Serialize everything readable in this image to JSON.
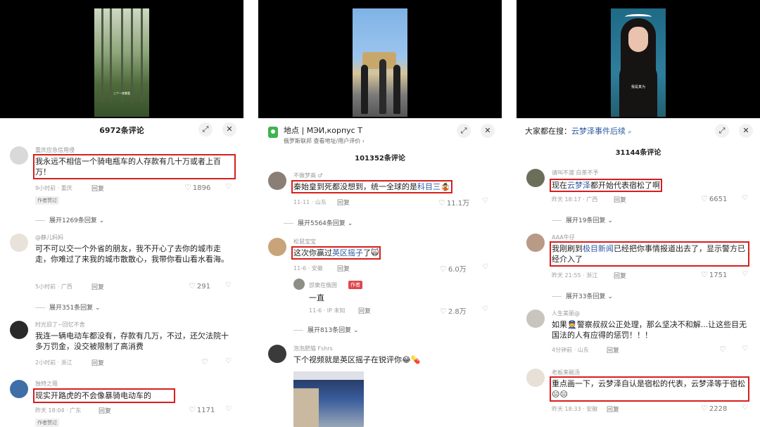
{
  "panel1": {
    "thumb_caption": "三个一夜暴富",
    "comment_count": "6972条评论",
    "comments": [
      {
        "user": "重庆应急信用侵",
        "text": "我永远不相信一个骑电瓶车的人存款有几十万或者上百万！",
        "time": "9小时前 · 重庆",
        "reply": "回复",
        "likes": "1896",
        "badge": "作者赞过",
        "expand": "展开1269条回复"
      },
      {
        "user": "@静儿妈妈",
        "text": "可不可以交一个外省的朋友，我不开心了去你的城市走走，你难过了来我的城市散散心，我带你看山看水看海。",
        "time": "5小时前 · 广西",
        "reply": "回复",
        "likes": "291",
        "expand": "展开351条回复"
      },
      {
        "user": "时光旧了~回忆不舍",
        "text": "我连一辆电动车都没有，存款有几万，不过，还欠法院十多万罚金，没交被限制了高消费",
        "time": "2小时前 · 浙江",
        "reply": "回复",
        "likes": ""
      },
      {
        "user": "独特之蔻",
        "text": "现实开路虎的不会像暴骑电动车的",
        "time": "昨天 18:04 · 广东",
        "reply": "回复",
        "likes": "1171",
        "badge": "作者赞过"
      }
    ]
  },
  "panel2": {
    "loc_title": "地点 | МЭИ,корпус Т",
    "loc_sub": "俄罗斯联邦  查看地址/用户评价 ›",
    "comment_count": "101352条评论",
    "comments": [
      {
        "user": "不做梦高 ♂",
        "text_pre": "秦始皇到死都没想到，统一全球的是",
        "keyword": "科目三",
        "text_post": "🤹",
        "time": "11-11 · 山东",
        "reply": "回复",
        "likes": "11.1万",
        "expand": "展开5564条回复"
      },
      {
        "user": "松鼠宝宝",
        "text_pre": "这次你赢过",
        "keyword": "英区摇子",
        "text_post": "了🙀",
        "time": "11-6 · 安徽",
        "reply": "回复",
        "likes": "6.0万"
      },
      {
        "user": "部東在俄国",
        "author_badge": "作者",
        "text": "一直",
        "time": "11-6 · IP 未知",
        "reply": "回复",
        "likes": "2.8万",
        "expand": "展开813条回复"
      },
      {
        "user": "泡泡肥猫 Fshrs",
        "text": "下个视频就是英区摇子在锐评你😂💊"
      }
    ]
  },
  "panel3": {
    "thumb_caption": "我是真为",
    "search_prefix": "大家都在搜：",
    "search_keyword": "云梦泽事件后续",
    "comment_count": "31144条评论",
    "comments": [
      {
        "user": "请叫不渡 白茶不予",
        "text_pre": "现在",
        "keyword": "云梦泽",
        "text_post": "都开始代表宿松了啊",
        "time": "昨天 18:17 · 广西",
        "reply": "回复",
        "likes": "6651",
        "expand": "展开19条回复"
      },
      {
        "user": "AAA牛仔",
        "text_pre": "我刚刷到",
        "keyword": "极目新闻",
        "text_post": "已经把你事情报道出去了，显示警方已经介入了",
        "time": "昨天 21:55 · 浙江",
        "reply": "回复",
        "likes": "1751",
        "expand": "展开33条回复"
      },
      {
        "user": "人生美丽@",
        "text": "如果👮警察叔叔公正处理，那么坚决不和解...让这些目无国法的人有应得的惩罚！！！",
        "time": "4分钟前 · 山东",
        "reply": "回复",
        "likes": ""
      },
      {
        "user": "老板来碗汤",
        "text": "重点画一下，云梦泽自认是宿松的代表，云梦泽等于宿松😑😑",
        "time": "昨天 18:33 · 安徽",
        "reply": "回复",
        "likes": "2228"
      }
    ]
  },
  "icons": {
    "expand": "fullscreen-icon",
    "close": "close-icon",
    "heart": "heart-icon",
    "dislike": "dislike-icon"
  }
}
